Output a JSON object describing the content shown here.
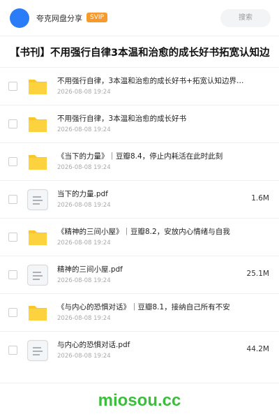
{
  "header": {
    "share_title": "夸克网盘分享",
    "badge": "SVIP",
    "search_label": "搜索"
  },
  "folder_title": "【书刊】不用强行自律3本温和治愈的成长好书拓宽认知边",
  "items": [
    {
      "type": "folder",
      "name": "不用强行自律，3本温和治愈的成长好书+拓宽认知边界…",
      "date": "2026-08-08 19:24",
      "size": ""
    },
    {
      "type": "folder",
      "name": "不用强行自律，3本温和治愈的成长好书",
      "date": "2026-08-08 19:24",
      "size": ""
    },
    {
      "type": "folder",
      "name": "《当下的力量》｜豆瓣8.4，停止内耗活在此时此刻",
      "date": "2026-08-08 19:24",
      "size": ""
    },
    {
      "type": "file",
      "name": "当下的力量.pdf",
      "date": "2026-08-08 19:24",
      "size": "1.6M"
    },
    {
      "type": "folder",
      "name": "《精神的三间小屋》｜豆瓣8.2，安放内心情绪与自我",
      "date": "2026-08-08 19:24",
      "size": ""
    },
    {
      "type": "file",
      "name": "精神的三间小屋.pdf",
      "date": "2026-08-08 19:24",
      "size": "25.1M"
    },
    {
      "type": "folder",
      "name": "《与内心的恐惧对话》｜豆瓣8.1，接纳自己所有不安",
      "date": "2026-08-08 19:24",
      "size": ""
    },
    {
      "type": "file",
      "name": "与内心的恐惧对话.pdf",
      "date": "2026-08-08 19:24",
      "size": "44.2M"
    }
  ],
  "watermark": "miosou.cc",
  "colors": {
    "avatar": "#2a7cf7",
    "svip_badge": "#f79a2c",
    "folder": "#fcc626",
    "watermark": "#3bbf3b"
  }
}
